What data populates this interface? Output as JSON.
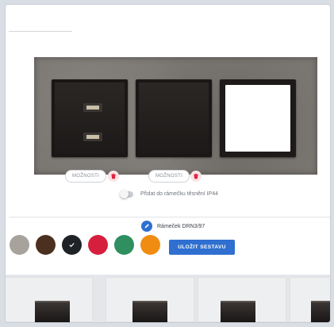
{
  "composer": {
    "modules": [
      {
        "type": "usb-double",
        "options_label": "MOŽNOSTI"
      },
      {
        "type": "blank",
        "options_label": "MOŽNOSTI"
      },
      {
        "type": "blank-white"
      }
    ],
    "ip44_toggle": {
      "label": "Přidat do rámečku těsnění IP44",
      "enabled": false
    },
    "frame": {
      "label": "Rámeček DRN3/97"
    },
    "colors": [
      {
        "name": "grey",
        "hex": "#a8a29d",
        "selected": false
      },
      {
        "name": "brown",
        "hex": "#4b2f1f",
        "selected": false
      },
      {
        "name": "black",
        "hex": "#1f2226",
        "selected": true
      },
      {
        "name": "red",
        "hex": "#d61f3c",
        "selected": false
      },
      {
        "name": "green",
        "hex": "#2f8f5f",
        "selected": false
      },
      {
        "name": "orange",
        "hex": "#f08c12",
        "selected": false
      }
    ],
    "save_label": "ULOŽIT SESTAVU"
  },
  "colors": {
    "accent": "#2f6fcf",
    "danger": "#e0233f"
  }
}
